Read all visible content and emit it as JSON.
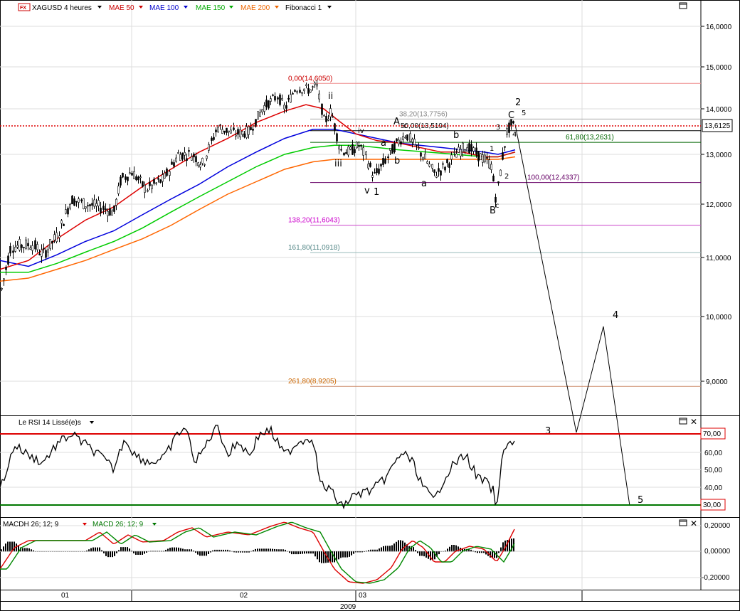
{
  "panels": {
    "price": {
      "header": [
        {
          "text": "XAGUSD 4 heures",
          "color": "#000000",
          "icon": "fx-icon"
        },
        {
          "text": "MAE 50",
          "color": "#cc0000"
        },
        {
          "text": "MAE 100",
          "color": "#0000cc"
        },
        {
          "text": "MAE 150",
          "color": "#00aa00"
        },
        {
          "text": "MAE 200",
          "color": "#ee6600"
        },
        {
          "text": "Fibonacci 1",
          "color": "#000000"
        }
      ],
      "current_price_label": "13,6125",
      "y_ticks": [
        "16,0000",
        "15,0000",
        "14,0000",
        "13,0000",
        "12,0000",
        "11,0000",
        "10,0000",
        "9,0000"
      ]
    },
    "rsi": {
      "title": "Le RSI 14 Lissé(e)s",
      "levels": [
        "70,00",
        "30,00"
      ],
      "y_ticks": [
        "60,00",
        "50,00",
        "40,00"
      ]
    },
    "macd": {
      "title_1": "MACDH 26; 12; 9",
      "title_2": "MACD 26; 12; 9",
      "y_ticks": [
        "0,20000",
        "0,00000",
        "-0,20000"
      ]
    },
    "time_axis": {
      "labels": [
        "01",
        "02",
        "03"
      ],
      "year": "2009"
    }
  },
  "fibonacci": [
    {
      "text": "0,00(14,6050)",
      "color": "#cc0000"
    },
    {
      "text": "38,20(13,7756)",
      "color": "#888888"
    },
    {
      "text": "50,00(13,5194)",
      "color": "#000000"
    },
    {
      "text": "61,80(13,2631)",
      "color": "#006600"
    },
    {
      "text": "100,00(12,4337)",
      "color": "#660066"
    },
    {
      "text": "138,20(11,6043)",
      "color": "#cc00cc"
    },
    {
      "text": "161,80(11,0918)",
      "color": "#558888"
    },
    {
      "text": "261,80(8,9205)",
      "color": "#cc6600"
    }
  ],
  "wave_labels": [
    "ii",
    "iii",
    "iv",
    "v",
    "1",
    "a",
    "b",
    "c",
    "A",
    "B",
    "C",
    "a",
    "b",
    "c",
    "1",
    "2",
    "3",
    "4",
    "5",
    "2",
    "3",
    "4",
    "5"
  ],
  "chart_data": {
    "type": "line",
    "title": "XAGUSD 4 heures",
    "series": [
      {
        "name": "XAGUSD",
        "x": [
          "01",
          "02",
          "03"
        ],
        "values": [
          10.6,
          12.8,
          13.6
        ]
      },
      {
        "name": "MAE 50"
      },
      {
        "name": "MAE 100"
      },
      {
        "name": "MAE 150"
      },
      {
        "name": "MAE 200"
      }
    ],
    "ylim": [
      8.5,
      16.5
    ],
    "colors": {
      "ma50": "#dd0000",
      "ma100": "#0000dd",
      "ma150": "#00cc00",
      "ma200": "#ff6600",
      "rsi_high": "#dd0000",
      "rsi_low": "#007700"
    }
  }
}
